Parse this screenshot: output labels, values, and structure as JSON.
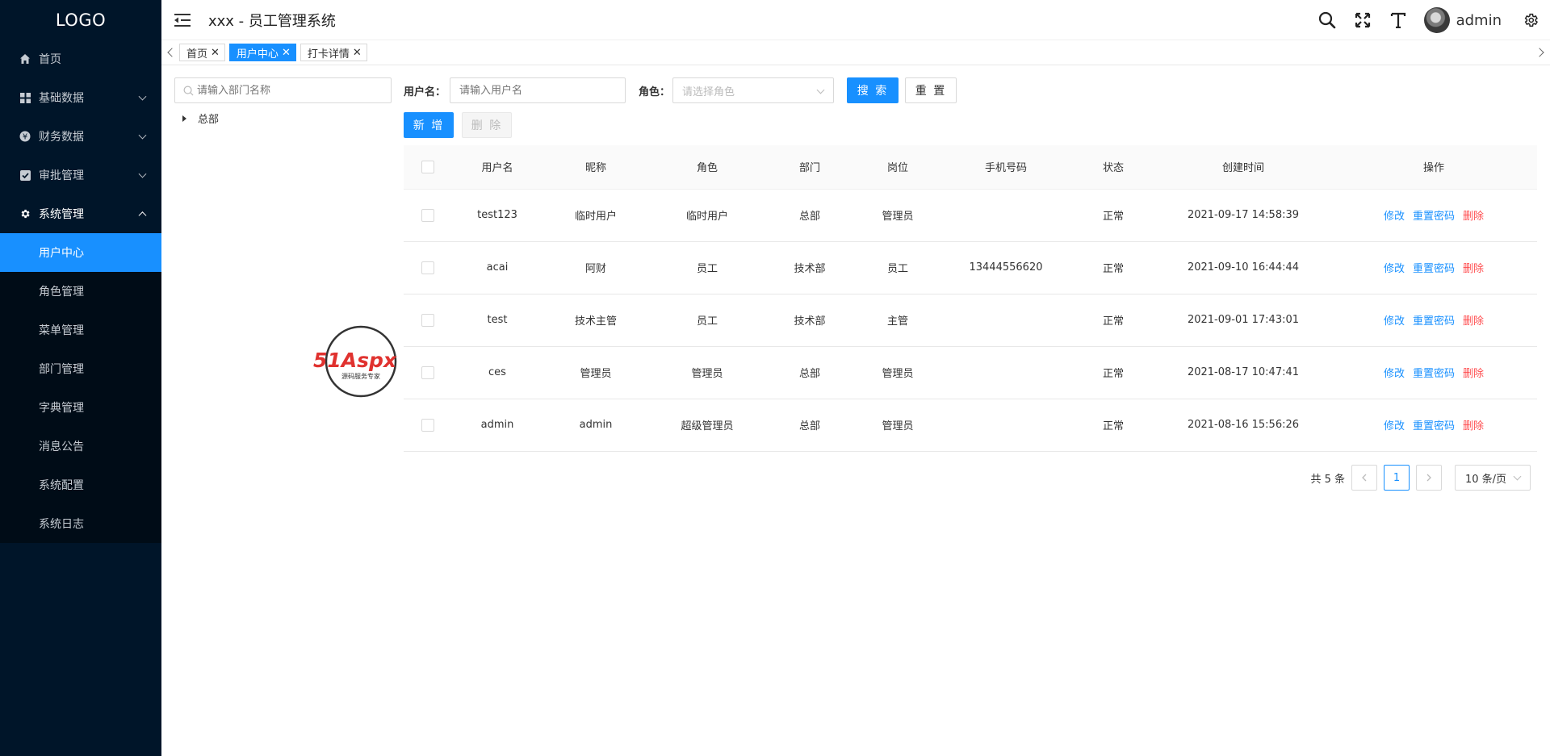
{
  "logo": "LOGO",
  "app_title": "xxx - 员工管理系统",
  "header": {
    "username": "admin"
  },
  "sidebar": {
    "items": [
      {
        "label": "首页"
      },
      {
        "label": "基础数据"
      },
      {
        "label": "财务数据"
      },
      {
        "label": "审批管理"
      },
      {
        "label": "系统管理"
      }
    ],
    "subitems": [
      {
        "label": "用户中心"
      },
      {
        "label": "角色管理"
      },
      {
        "label": "菜单管理"
      },
      {
        "label": "部门管理"
      },
      {
        "label": "字典管理"
      },
      {
        "label": "消息公告"
      },
      {
        "label": "系统配置"
      },
      {
        "label": "系统日志"
      }
    ]
  },
  "tabs": [
    {
      "label": "首页"
    },
    {
      "label": "用户中心"
    },
    {
      "label": "打卡详情"
    }
  ],
  "tree": {
    "search_placeholder": "请输入部门名称",
    "root": "总部"
  },
  "form": {
    "username_label": "用户名：",
    "username_placeholder": "请输入用户名",
    "role_label": "角色：",
    "role_placeholder": "请选择角色",
    "search_btn": "搜 索",
    "reset_btn": "重 置",
    "add_btn": "新 增",
    "delete_btn": "删 除"
  },
  "table": {
    "headers": [
      "用户名",
      "昵称",
      "角色",
      "部门",
      "岗位",
      "手机号码",
      "状态",
      "创建时间",
      "操作"
    ],
    "op_edit": "修改",
    "op_reset": "重置密码",
    "op_delete": "删除",
    "rows": [
      {
        "username": "test123",
        "nickname": "临时用户",
        "role": "临时用户",
        "dept": "总部",
        "post": "管理员",
        "phone": "",
        "status": "正常",
        "created": "2021-09-17 14:58:39"
      },
      {
        "username": "acai",
        "nickname": "阿财",
        "role": "员工",
        "dept": "技术部",
        "post": "员工",
        "phone": "13444556620",
        "status": "正常",
        "created": "2021-09-10 16:44:44"
      },
      {
        "username": "test",
        "nickname": "技术主管",
        "role": "员工",
        "dept": "技术部",
        "post": "主管",
        "phone": "",
        "status": "正常",
        "created": "2021-09-01 17:43:01"
      },
      {
        "username": "ces",
        "nickname": "管理员",
        "role": "管理员",
        "dept": "总部",
        "post": "管理员",
        "phone": "",
        "status": "正常",
        "created": "2021-08-17 10:47:41"
      },
      {
        "username": "admin",
        "nickname": "admin",
        "role": "超级管理员",
        "dept": "总部",
        "post": "管理员",
        "phone": "",
        "status": "正常",
        "created": "2021-08-16 15:56:26"
      }
    ]
  },
  "pager": {
    "total": "共 5 条",
    "current": "1",
    "page_size": "10 条/页"
  },
  "watermark": {
    "brand": "51Aspx",
    "tagline": "源码服务专家"
  },
  "colors": {
    "sidebar_bg": "#001529",
    "accent": "#1890ff",
    "danger": "#ff4d4f"
  }
}
